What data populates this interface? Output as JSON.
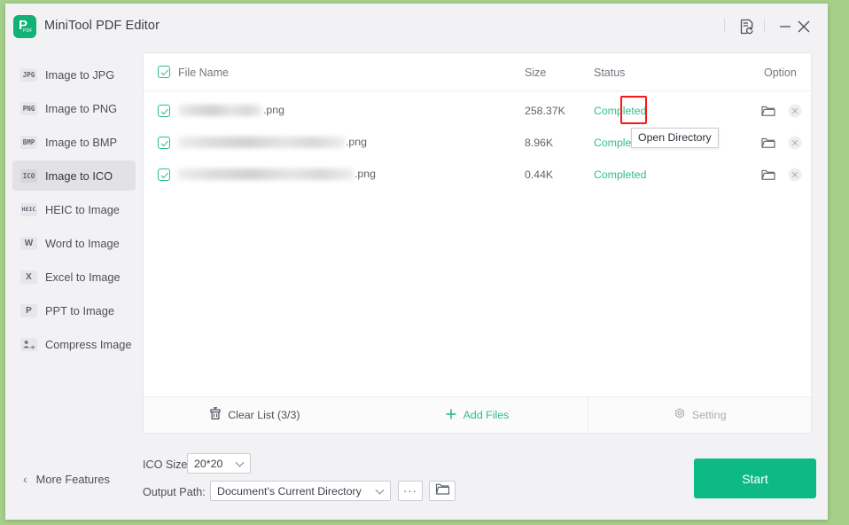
{
  "app": {
    "title": "MiniTool PDF Editor",
    "logo_letter": "P",
    "logo_sub": "PDF"
  },
  "titlebar": {
    "feedback_icon": "document-refresh-icon",
    "minimize_icon": "minimize-icon",
    "close_icon": "close-icon"
  },
  "sidebar": {
    "items": [
      {
        "badge": "JPG",
        "label": "Image to JPG",
        "active": false
      },
      {
        "badge": "PNG",
        "label": "Image to PNG",
        "active": false
      },
      {
        "badge": "BMP",
        "label": "Image to BMP",
        "active": false
      },
      {
        "badge": "ICO",
        "label": "Image to ICO",
        "active": true
      },
      {
        "badge": "HEIC",
        "label": "HEIC to Image",
        "active": false
      },
      {
        "badge": "W",
        "label": "Word to Image",
        "active": false
      },
      {
        "badge": "X",
        "label": "Excel to Image",
        "active": false
      },
      {
        "badge": "P",
        "label": "PPT to Image",
        "active": false
      },
      {
        "badge": "",
        "label": "Compress Image",
        "active": false
      }
    ],
    "more_features": "More Features",
    "back_chevron": "chevron-left-icon"
  },
  "file_list": {
    "header_checkbox_checked": true,
    "columns": {
      "file_name": "File Name",
      "size": "Size",
      "status": "Status",
      "option": "Option"
    },
    "rows": [
      {
        "name_redacted": true,
        "name_width": 95,
        "extension": ".png",
        "size": "258.37K",
        "status": "Completed",
        "checked": true
      },
      {
        "name_redacted": true,
        "name_width": 188,
        "extension": ".png",
        "size": "8.96K",
        "status": "Completed",
        "checked": true
      },
      {
        "name_redacted": true,
        "name_width": 198,
        "extension": ".png",
        "size": "0.44K",
        "status": "Completed",
        "checked": true
      }
    ],
    "row_actions": {
      "open_directory_icon": "folder-open-icon",
      "remove_icon": "close-circle-icon"
    }
  },
  "tooltip": {
    "text": "Open Directory",
    "visible": true
  },
  "panel_footer": {
    "clear_list": "Clear List (3/3)",
    "clear_list_icon": "trash-icon",
    "add_files": "Add Files",
    "add_files_icon": "plus-icon",
    "setting": "Setting",
    "setting_icon": "gear-icon",
    "setting_disabled": true
  },
  "controls": {
    "ico_size_label": "ICO Size:",
    "ico_size_value": "20*20",
    "output_path_label": "Output Path:",
    "output_path_value": "Document's Current Directory",
    "browse_dots": "···",
    "open_folder_icon": "folder-open-icon",
    "start_label": "Start"
  },
  "colors": {
    "accent_green": "#0dba86",
    "status_green": "#2dbd8a",
    "window_bg": "#f2f2f4",
    "desktop_bg": "#a6cf8b",
    "highlight_red": "#ff1414"
  }
}
